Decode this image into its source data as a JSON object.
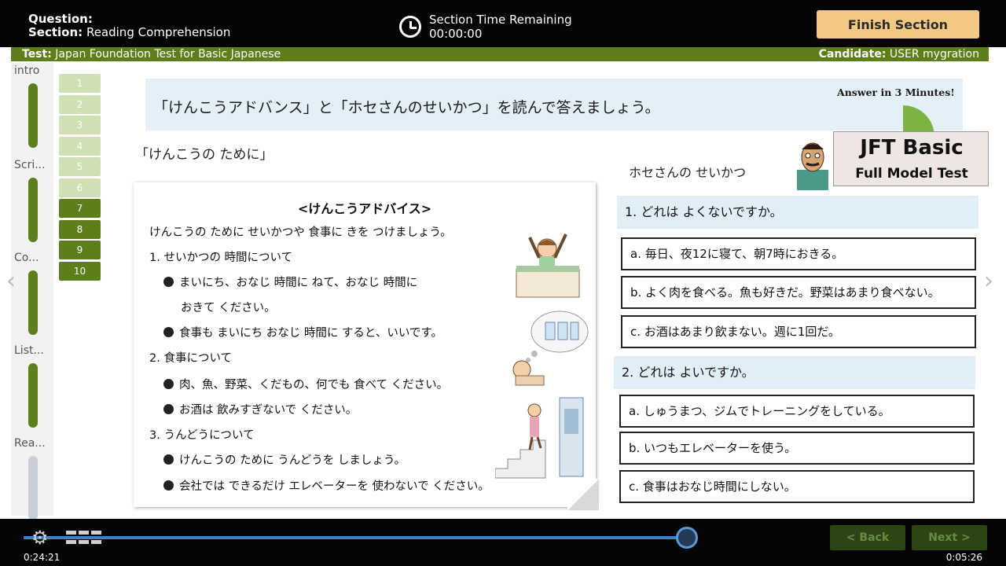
{
  "header": {
    "question_label": "Question:",
    "section_label": "Section:",
    "section_value": "Reading Comprehension",
    "timer_label": "Section Time Remaining",
    "timer_value": "00:00:00",
    "finish_label": "Finish Section"
  },
  "infobar": {
    "test_label": "Test:",
    "test_value": "Japan Foundation Test for Basic Japanese",
    "candidate_label": "Candidate:",
    "candidate_value": "USER mygration"
  },
  "sidebar": {
    "sections": [
      {
        "label": "intro"
      },
      {
        "label": "Scri..."
      },
      {
        "label": "Co..."
      },
      {
        "label": "List..."
      },
      {
        "label": "Rea..."
      }
    ],
    "questions": [
      "1",
      "2",
      "3",
      "4",
      "5",
      "6",
      "7",
      "8",
      "9",
      "10"
    ]
  },
  "content": {
    "instruction": "「けんこうアドバンス」と「ホセさんのせいかつ」を読んで答えましょう。",
    "answer_note": "Answer in 3 Minutes!",
    "subtitle": "「けんこうの ために」",
    "memo": {
      "title": "<けんこうアドバイス>",
      "intro": "けんこうの ために せいかつや 食事に きを つけましょう。",
      "h1": "1. せいかつの 時間について",
      "b1": "まいにち、おなじ 時間に ねて、おなじ 時間に",
      "b1cont": "おきて ください。",
      "b2": "食事も まいにち おなじ 時間に すると、いいです。",
      "h2": "2. 食事について",
      "b3": "肉、魚、野菜、くだもの、何でも 食べて ください。",
      "b4": "お酒は 飲みすぎないで ください。",
      "h3": "3. うんどうについて",
      "b5": "けんこうの ために うんどうを しましょう。",
      "b6": "会社では できるだけ エレベーターを 使わないで ください。"
    },
    "hose_title": "ホセさんの せいかつ",
    "logo_main": "JFT Basic",
    "logo_sub": "Full Model Test",
    "q1": {
      "text": "1. どれは よくないですか。",
      "options": [
        "a. 毎日、夜12に寝て、朝7時におきる。",
        "b. よく肉を食べる。魚も好きだ。野菜はあまり食べない。",
        "c. お酒はあまり飲まない。週に1回だ。"
      ]
    },
    "q2": {
      "text": "2. どれは よいですか。",
      "options": [
        "a. しゅうまつ、ジムでトレーニングをしている。",
        "b. いつもエレベーターを使う。",
        "c. 食事はおなじ時間にしない。"
      ]
    }
  },
  "player": {
    "progress": 0.82,
    "back_label": "< Back",
    "next_label": "Next >",
    "time_elapsed": "0:24:21",
    "time_total": "0:05:26"
  }
}
